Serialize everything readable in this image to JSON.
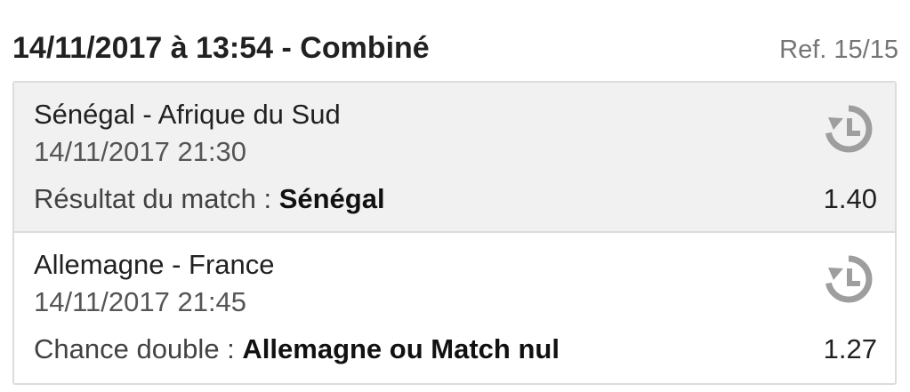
{
  "header": {
    "title": "14/11/2017 à 13:54 - Combiné",
    "ref": "Ref. 15/15"
  },
  "bets": [
    {
      "match": "Sénégal - Afrique du Sud",
      "datetime": "14/11/2017 21:30",
      "market_label": "Résultat du match : ",
      "selection": "Sénégal",
      "odds": "1.40",
      "icon": "history-icon"
    },
    {
      "match": "Allemagne - France",
      "datetime": "14/11/2017 21:45",
      "market_label": "Chance double : ",
      "selection": "Allemagne ou Match nul",
      "odds": "1.27",
      "icon": "history-icon"
    }
  ],
  "colors": {
    "title": "#212121",
    "ref": "#757575",
    "icon": "#9e9e9e",
    "first_bet_bg": "#f1f1f1",
    "border": "#dcdcdc"
  }
}
